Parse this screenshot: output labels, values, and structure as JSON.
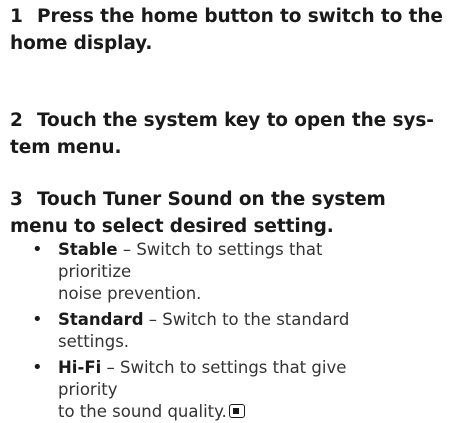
{
  "steps": [
    {
      "num": "1",
      "line1": "Press the home button to switch to the",
      "line2": "home display."
    },
    {
      "num": "2",
      "line1": "Touch the system key to open the sys-",
      "line2": "tem menu."
    },
    {
      "num": "3",
      "line1": "Touch Tuner Sound on the system",
      "line2": "menu to select desired setting."
    }
  ],
  "options": [
    {
      "term": "Stable",
      "desc_line1": " – Switch to settings that prioritize",
      "desc_line2": "noise prevention."
    },
    {
      "term": "Standard",
      "desc_line1": " – Switch to the standard settings.",
      "desc_line2": ""
    },
    {
      "term": "Hi-Fi",
      "desc_line1": " – Switch to settings that give priority",
      "desc_line2": "to the sound quality."
    }
  ],
  "bullet": "•",
  "end_icon": "end-of-section-icon"
}
